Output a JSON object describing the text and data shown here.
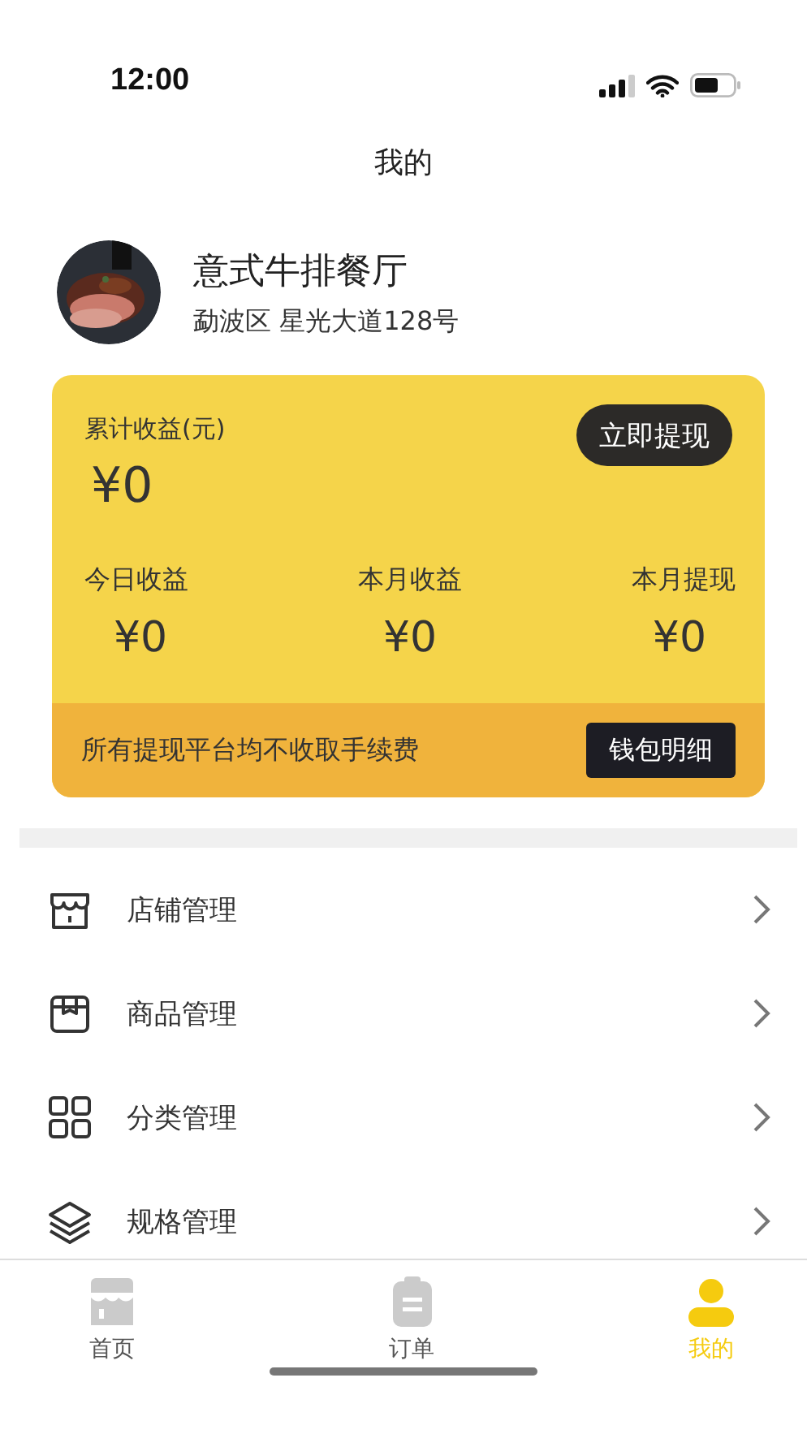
{
  "status_bar": {
    "time": "12:00"
  },
  "title": "我的",
  "profile": {
    "name": "意式牛排餐厅",
    "address": "勐波区 星光大道128号"
  },
  "earnings": {
    "total_label": "累计收益(元)",
    "total_value": "¥0",
    "withdraw_button": "立即提现",
    "stats": [
      {
        "label": "今日收益",
        "value": "¥0"
      },
      {
        "label": "本月收益",
        "value": "¥0"
      },
      {
        "label": "本月提现",
        "value": "¥0"
      }
    ],
    "notice": "所有提现平台均不收取手续费",
    "wallet_button": "钱包明细"
  },
  "menu": [
    {
      "kind": "store",
      "label": "店铺管理"
    },
    {
      "kind": "box",
      "label": "商品管理"
    },
    {
      "kind": "grid",
      "label": "分类管理"
    },
    {
      "kind": "layers",
      "label": "规格管理"
    }
  ],
  "tabs": [
    {
      "kind": "store",
      "label": "首页",
      "selected": false
    },
    {
      "kind": "clipboard",
      "label": "订单",
      "selected": false
    },
    {
      "kind": "person",
      "label": "我的",
      "selected": true
    }
  ]
}
